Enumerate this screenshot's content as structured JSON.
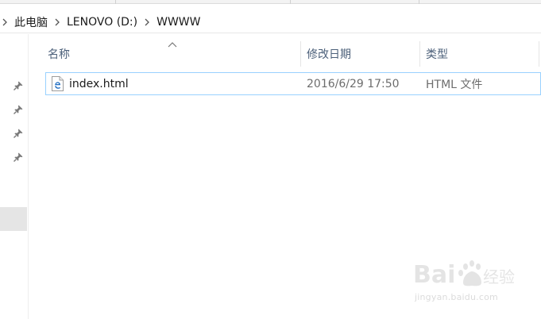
{
  "address_bar": {
    "crumbs": [
      "此电脑",
      "LENOVO (D:)",
      "WWWW"
    ]
  },
  "columns": {
    "name": "名称",
    "date": "修改日期",
    "type": "类型"
  },
  "files": [
    {
      "name": "index.html",
      "modified": "2016/6/29 17:50",
      "type": "HTML 文件",
      "icon": "edge-html-file-icon"
    }
  ],
  "nav_pane": {
    "pins": [
      "pin-icon",
      "pin-icon",
      "pin-icon",
      "pin-icon"
    ]
  },
  "watermark": {
    "logo": "Baidu经验",
    "url": "jingyan.baidu.com"
  },
  "colors": {
    "selection_border": "#99d1ff",
    "header_text": "#4c607a",
    "edge_blue": "#1f6dc2"
  }
}
